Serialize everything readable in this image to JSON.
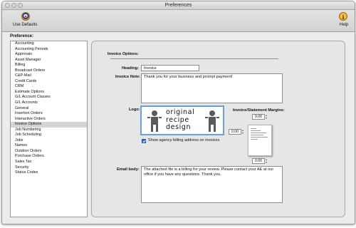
{
  "window": {
    "title": "Preferences"
  },
  "toolbar": {
    "use_defaults_label": "Use Defaults",
    "help_label": "Help",
    "use_defaults_icon": "brand-badge-icon",
    "help_icon": "info-icon",
    "accent": "#2a6fd0"
  },
  "preferences_label": "Preference:",
  "sidebar": {
    "items": [
      "Accounting",
      "Accounting Periods",
      "Approvals",
      "Asset Manager",
      "Billing",
      "Broadcast Orders",
      "C&P-Mail",
      "Credit Cards",
      "CRM",
      "Estimate Options",
      "G/L Account Classes",
      "G/L Accounts",
      "General",
      "Insertion Orders",
      "Interactive Orders",
      "Invoice Options",
      "Job Numbering",
      "Job Scheduling",
      "Jobs",
      "Names",
      "Outdoor Orders",
      "Purchase Orders",
      "Sales Tax",
      "Security",
      "Status Codes"
    ],
    "selected": "Invoice Options"
  },
  "invoice": {
    "section_title": "Invoice Options:",
    "heading_label": "Heading:",
    "heading_value": "Invoice",
    "note_label": "Invoice Note:",
    "note_value": "Thank you for your business and prompt payment!",
    "logo_label": "Logo:",
    "logo_text_1": "original",
    "logo_text_2": "recipe",
    "logo_text_3": "design",
    "show_address_label": "Show agency billing address on invoices",
    "show_address_checked": true,
    "margins_label": "Invoice/Statement Margins:",
    "margin_top": "0.00",
    "margin_left": "0.00",
    "margin_bottom": "0.00",
    "email_label": "Email body:",
    "email_value": "The attached file is a billing for your review. Please contact your AE at our office if you have any questions. Thank you."
  }
}
